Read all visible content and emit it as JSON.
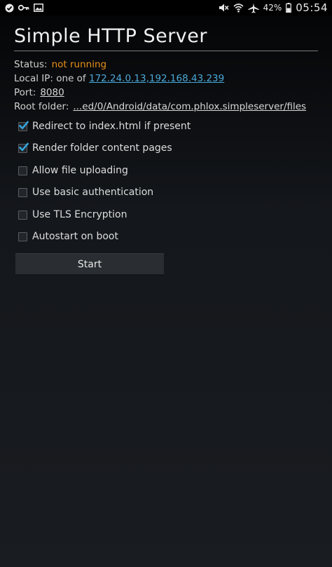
{
  "status_bar": {
    "battery_percent": "42%",
    "time": "05:54",
    "left_icons": [
      "check-circle-icon",
      "key-icon",
      "image-icon"
    ],
    "right_icons": [
      "mute-icon",
      "wifi-icon",
      "airplane-icon",
      "battery-icon"
    ]
  },
  "app": {
    "title": "Simple HTTP Server",
    "status_label": "Status:",
    "status_value": "not running",
    "local_ip_label": "Local IP:",
    "local_ip_prefix": "one of",
    "ip_1": "172.24.0.13",
    "ip_2": "192.168.43.239",
    "port_label": "Port:",
    "port_value": "8080",
    "root_label": "Root folder:",
    "root_value": "...ed/0/Android/data/com.phlox.simpleserver/files"
  },
  "options": [
    {
      "label": "Redirect to index.html if present",
      "checked": true
    },
    {
      "label": "Render folder content pages",
      "checked": true
    },
    {
      "label": "Allow file uploading",
      "checked": false
    },
    {
      "label": "Use basic authentication",
      "checked": false
    },
    {
      "label": "Use TLS Encryption",
      "checked": false
    },
    {
      "label": "Autostart on boot",
      "checked": false
    }
  ],
  "start_button": {
    "label": "Start"
  },
  "colors": {
    "accent_orange": "#e8901a",
    "link_blue": "#4aa8d8",
    "check_blue": "#33a4dd"
  }
}
